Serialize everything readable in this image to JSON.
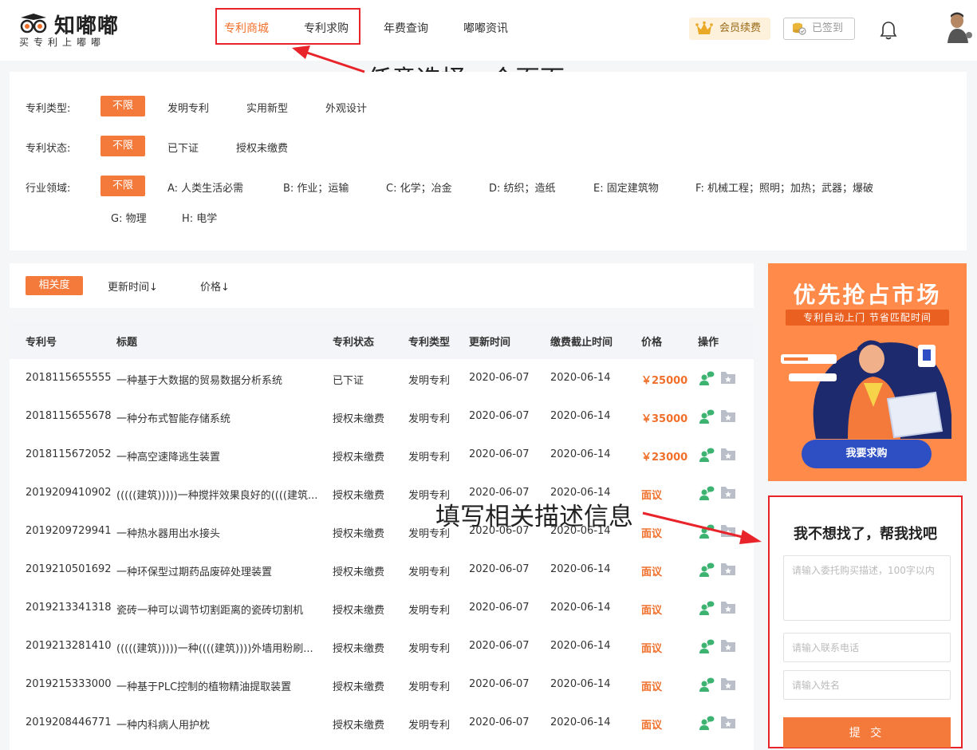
{
  "header": {
    "logo_name": "知嘟嘟",
    "logo_slogan": "买专利上嘟嘟",
    "nav": [
      "专利商城",
      "专利求购",
      "年费查询",
      "嘟嘟资讯"
    ],
    "vip_label": "会员续费",
    "sign_label": "已签到"
  },
  "annotations": {
    "nav_hint": "任意选择一个页面",
    "form_hint": "填写相关描述信息"
  },
  "filters": {
    "patent_type": {
      "label": "专利类型:",
      "options": [
        "不限",
        "发明专利",
        "实用新型",
        "外观设计"
      ]
    },
    "patent_status": {
      "label": "专利状态:",
      "options": [
        "不限",
        "已下证",
        "授权未缴费"
      ]
    },
    "industry": {
      "label": "行业领域:",
      "options": [
        "不限",
        "A: 人类生活必需",
        "B: 作业；运输",
        "C: 化学；冶金",
        "D: 纺织；造纸",
        "E: 固定建筑物",
        "F: 机械工程；照明；加热；武器；爆破",
        "G: 物理",
        "H: 电学"
      ]
    }
  },
  "sort": [
    "相关度",
    "更新时间↓",
    "价格↓"
  ],
  "table": {
    "headers": [
      "专利号",
      "标题",
      "专利状态",
      "专利类型",
      "更新时间",
      "缴费截止时间",
      "价格",
      "操作"
    ],
    "rows": [
      [
        "2018115655555",
        "一种基于大数据的贸易数据分析系统",
        "已下证",
        "发明专利",
        "2020-06-07",
        "2020-06-14",
        "￥25000"
      ],
      [
        "2018115655678",
        "一种分布式智能存储系统",
        "授权未缴费",
        "发明专利",
        "2020-06-07",
        "2020-06-14",
        "￥35000"
      ],
      [
        "2018115672052",
        "一种高空速降逃生装置",
        "授权未缴费",
        "发明专利",
        "2020-06-07",
        "2020-06-14",
        "￥23000"
      ],
      [
        "2019209410902",
        "(((((建筑)))))一种搅拌效果良好的((((建筑...",
        "授权未缴费",
        "发明专利",
        "2020-06-07",
        "2020-06-14",
        "面议"
      ],
      [
        "2019209729941",
        "一种热水器用出水接头",
        "授权未缴费",
        "发明专利",
        "2020-06-07",
        "2020-06-14",
        "面议"
      ],
      [
        "2019210501692",
        "一种环保型过期药品废碎处理装置",
        "授权未缴费",
        "发明专利",
        "2020-06-07",
        "2020-06-14",
        "面议"
      ],
      [
        "2019213341318",
        "瓷砖一种可以调节切割距离的瓷砖切割机",
        "授权未缴费",
        "发明专利",
        "2020-06-07",
        "2020-06-14",
        "面议"
      ],
      [
        "2019213281410",
        "(((((建筑)))))一种((((建筑))))外墙用粉刷...",
        "授权未缴费",
        "发明专利",
        "2020-06-07",
        "2020-06-14",
        "面议"
      ],
      [
        "2019215333000",
        "一种基于PLC控制的植物精油提取装置",
        "授权未缴费",
        "发明专利",
        "2020-06-07",
        "2020-06-14",
        "面议"
      ],
      [
        "2019208446771",
        "一种内科病人用护枕",
        "授权未缴费",
        "发明专利",
        "2020-06-07",
        "2020-06-14",
        "面议"
      ]
    ]
  },
  "banner": {
    "title": "优先抢占市场",
    "subtitle": "专利自动上门 节省匹配时间",
    "button": "我要求购"
  },
  "form": {
    "title": "我不想找了，帮我找吧",
    "desc_placeholder": "请输入委托购买描述，100字以内",
    "phone_placeholder": "请输入联系电话",
    "name_placeholder": "请输入姓名",
    "submit": "提 交"
  },
  "colors": {
    "accent": "#f47a3c",
    "highlight": "#e8242a",
    "banner_button": "#2e4fc4",
    "op_green": "#3cb371"
  }
}
